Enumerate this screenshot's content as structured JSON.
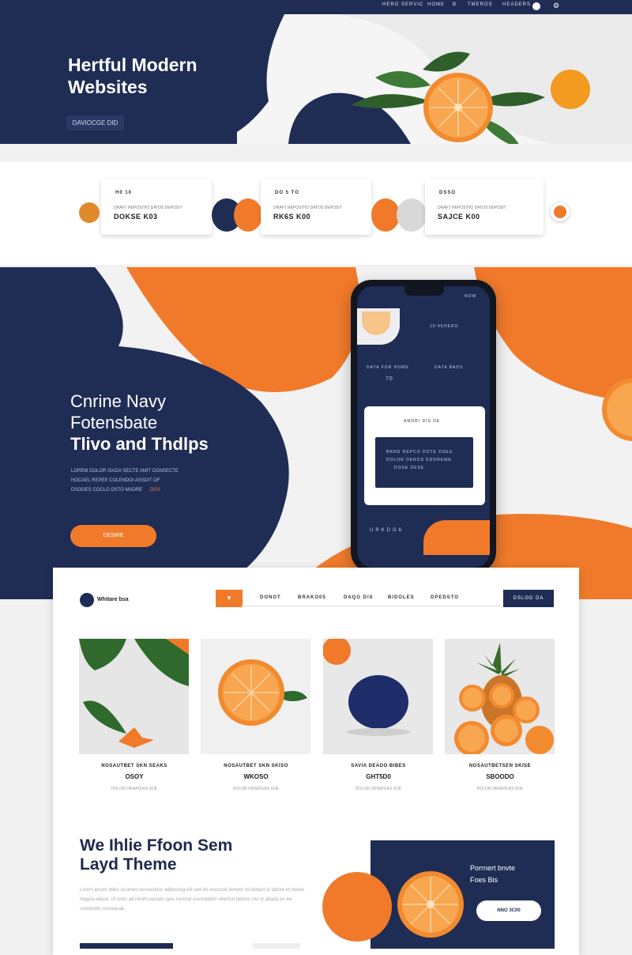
{
  "topbar": {
    "nav": [
      "HERO SERVIC",
      "HOME",
      "B",
      "TMEROS",
      "HEADERS"
    ]
  },
  "hero": {
    "title_line1": "Hertful Modern",
    "title_line2": "Websites",
    "button_label": "DAVIOCGE  DID"
  },
  "stats": [
    {
      "label": "H0 10",
      "sub": "DRAFT REPOSITIO DATOS DEPOSIT",
      "value": "DOKSE K03"
    },
    {
      "label": "DO 5 TO",
      "sub": "DRAFT REPOSITIO DATOS DEPOSIT",
      "value": "RK6S K00"
    },
    {
      "label": "DSSO",
      "sub": "DRAFT REPOSITIO DATOS DEPOSIT",
      "value": "SAJCE K00"
    }
  ],
  "feature": {
    "title_line1": "Cnrine Navy",
    "title_line2": "Fotensbate",
    "title_line3": "Tlivo and Thdlps",
    "body_line1": "LOREM DOLOR ISADA SECTE AMIT CONSECTE",
    "body_line2": "HOCAEL REPEE COLENDOI ASSDIT OF",
    "body_line3": "DSOGES COCLO DSTO MADRE",
    "body_accent": "DOS",
    "button_label": "DESIRE"
  },
  "phone": {
    "top_labels": [
      "HERO",
      "NOW"
    ],
    "time": "10:45",
    "mid_label_1": "DATA FOR HOME",
    "mid_label_2": "DATA BADS",
    "mid_value": "70",
    "card_title": "AMDRI DIS DE",
    "card_line1": "BRNG REPCO DOTE DSES",
    "card_line2": "DOLOR DEROS EDOREMA",
    "card_line3": "DOSE DESE",
    "bottom_label": "URKDG6"
  },
  "site": {
    "logo_text": "Whitare bsa",
    "nav": [
      "DONOT",
      "BRAKO05",
      "DAQG DIS",
      "BIDOLES",
      "DPEDSTO"
    ],
    "cta": "DSLOD DA",
    "products": [
      {
        "name": "NOSAUTBET SKN SEAKS",
        "price": "OSOY",
        "note": "DOLOR ORNATEAS SOE"
      },
      {
        "name": "NOSAUTBET SKN SKISO",
        "price": "WKOSO",
        "note": "DOLOR ORNATEAS SOE"
      },
      {
        "name": "SAVIA DEADO BIBES",
        "price": "GHT5D0",
        "note": "DOLOR ORNATEAS SOE"
      },
      {
        "name": "NOSAUTBETSEN SKISE",
        "price": "SBOODO",
        "note": "DOLOR ORNATEAS SOE"
      }
    ],
    "theme_title_line1": "We Ihlie Ffoon Sem",
    "theme_title_line2": "Layd Theme",
    "theme_body": "Lorem ipsum dolor sit amet consectetur adipiscing elit sed do eiusmod tempor incididunt ut labore et dolore magna aliqua. Ut enim ad minim veniam quis nostrud exercitation ullamco laboris nisi ut aliquip ex ea commodo consequat.",
    "promo_title_line1": "Porrnert bnvte",
    "promo_title_line2": "Foes Bis",
    "promo_button": "NNO 3C00"
  },
  "colors": {
    "navy": "#1f2d55",
    "orange": "#f07a2a",
    "light": "#f2f2f2"
  }
}
